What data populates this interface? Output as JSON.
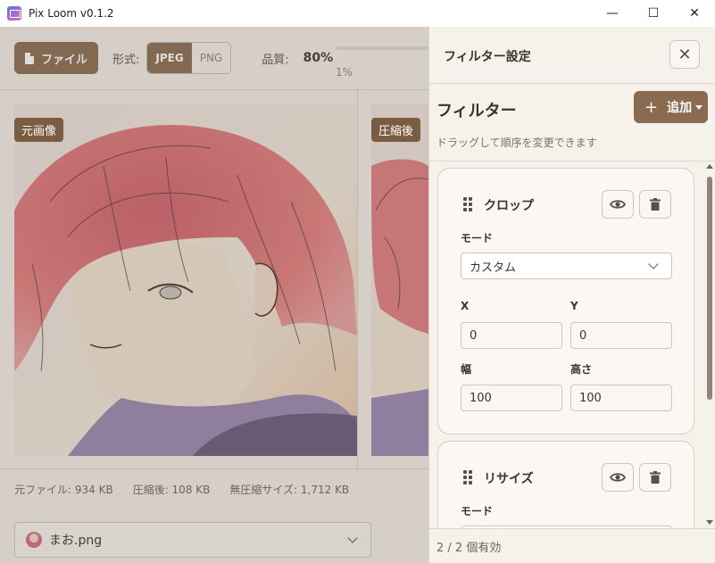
{
  "window": {
    "title": "Pix Loom v0.1.2",
    "minimize_glyph": "—",
    "maximize_glyph": "☐",
    "close_glyph": "✕"
  },
  "toolbar": {
    "file_label": "ファイル",
    "format_label": "形式:",
    "formats": [
      "JPEG",
      "PNG"
    ],
    "selected_format": "JPEG",
    "quality_label": "品質:",
    "quality_value": "80%",
    "quality_min": "1%"
  },
  "preview": {
    "original_label": "元画像",
    "compressed_label": "圧縮後"
  },
  "sizes": {
    "original": "元ファイル: 934 KB",
    "compressed": "圧縮後: 108 KB",
    "uncompressed": "無圧縮サイズ: 1,712 KB"
  },
  "file_select": {
    "value": "まお.png"
  },
  "panel": {
    "title": "フィルター設定",
    "close_glyph": "✕",
    "heading": "フィルター",
    "add_label": "追加",
    "hint": "ドラッグして順序を変更できます",
    "filters": [
      {
        "name": "クロップ",
        "mode_label": "モード",
        "mode_value": "カスタム",
        "x_label": "X",
        "x_value": "0",
        "y_label": "Y",
        "y_value": "0",
        "w_label": "幅",
        "w_value": "100",
        "h_label": "高さ",
        "h_value": "100"
      },
      {
        "name": "リサイズ",
        "mode_label": "モード"
      }
    ],
    "footer": "2 / 2 個有効"
  },
  "colors": {
    "accent": "#8a6b4f",
    "panel_bg": "#f6f1ea",
    "card_border": "#d7cdc2"
  }
}
